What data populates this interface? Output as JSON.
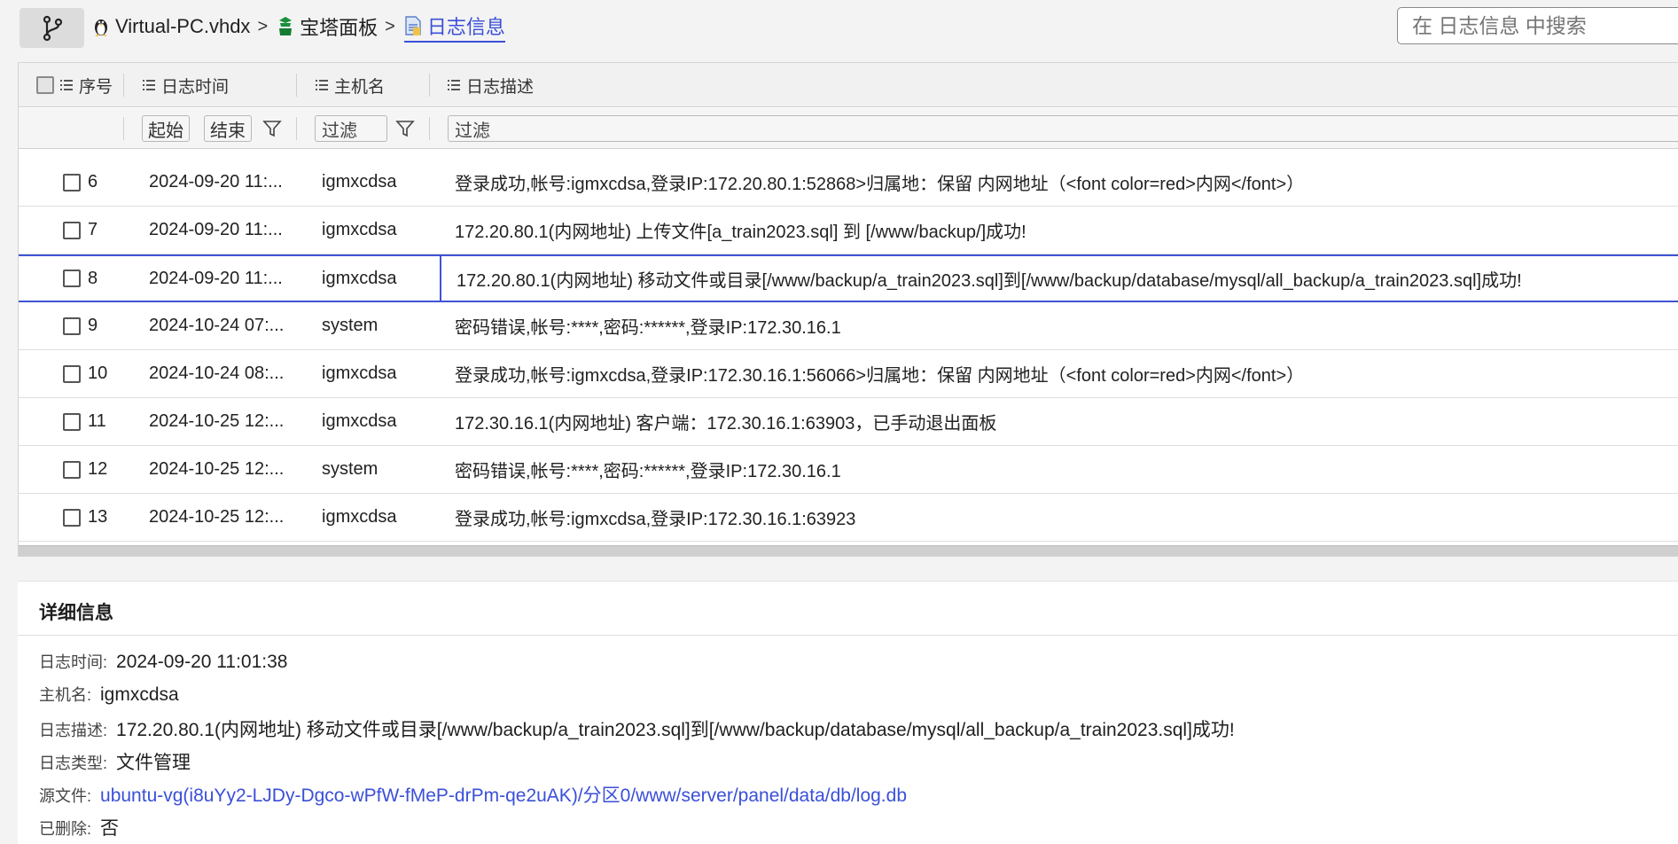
{
  "breadcrumb": {
    "items": [
      {
        "label": "Virtual-PC.vhdx",
        "icon": "linux-penguin-icon"
      },
      {
        "label": "宝塔面板",
        "icon": "baota-panel-icon"
      },
      {
        "label": "日志信息",
        "icon": "log-file-icon"
      }
    ],
    "separator": ">"
  },
  "search": {
    "placeholder": "在 日志信息 中搜索"
  },
  "grid": {
    "columns": {
      "seq": "序号",
      "time": "日志时间",
      "host": "主机名",
      "desc": "日志描述"
    },
    "filters": {
      "start": "起始",
      "end": "结束",
      "host": "过滤",
      "desc": "过滤"
    },
    "rows": [
      {
        "seq": "6",
        "time": "2024-09-20 11:...",
        "host": "igmxcdsa",
        "desc": "登录成功,帐号:igmxcdsa,登录IP:172.20.80.1:52868>归属地：保留 内网地址（<font color=red>内网</font>）"
      },
      {
        "seq": "7",
        "time": "2024-09-20 11:...",
        "host": "igmxcdsa",
        "desc": "172.20.80.1(内网地址) 上传文件[a_train2023.sql] 到 [/www/backup/]成功!"
      },
      {
        "seq": "8",
        "time": "2024-09-20 11:...",
        "host": "igmxcdsa",
        "desc": "172.20.80.1(内网地址) 移动文件或目录[/www/backup/a_train2023.sql]到[/www/backup/database/mysql/all_backup/a_train2023.sql]成功!"
      },
      {
        "seq": "9",
        "time": "2024-10-24 07:...",
        "host": "system",
        "desc": "密码错误,帐号:****,密码:******,登录IP:172.30.16.1"
      },
      {
        "seq": "10",
        "time": "2024-10-24 08:...",
        "host": "igmxcdsa",
        "desc": "登录成功,帐号:igmxcdsa,登录IP:172.30.16.1:56066>归属地：保留 内网地址（<font color=red>内网</font>）"
      },
      {
        "seq": "11",
        "time": "2024-10-25 12:...",
        "host": "igmxcdsa",
        "desc": "172.30.16.1(内网地址) 客户端：172.30.16.1:63903，已手动退出面板"
      },
      {
        "seq": "12",
        "time": "2024-10-25 12:...",
        "host": "system",
        "desc": "密码错误,帐号:****,密码:******,登录IP:172.30.16.1"
      },
      {
        "seq": "13",
        "time": "2024-10-25 12:...",
        "host": "igmxcdsa",
        "desc": "登录成功,帐号:igmxcdsa,登录IP:172.30.16.1:63923"
      }
    ],
    "selected_seq": "8"
  },
  "details": {
    "title": "详细信息",
    "fields": [
      {
        "label": "日志时间:",
        "value": "2024-09-20 11:01:38"
      },
      {
        "label": "主机名:",
        "value": "igmxcdsa"
      },
      {
        "label": "日志描述:",
        "value": "172.20.80.1(内网地址) 移动文件或目录[/www/backup/a_train2023.sql]到[/www/backup/database/mysql/all_backup/a_train2023.sql]成功!"
      },
      {
        "label": "日志类型:",
        "value": "文件管理"
      },
      {
        "label": "源文件:",
        "value": "ubuntu-vg(i8uYy2-LJDy-Dgco-wPfW-fMeP-drPm-qe2uAK)/分区0/www/server/panel/data/db/log.db"
      },
      {
        "label": "已删除:",
        "value": "否"
      }
    ]
  },
  "colors": {
    "accent": "#3a4fd8",
    "selection_border": "#3f53d6",
    "baota_green": "#1a8f3c"
  }
}
